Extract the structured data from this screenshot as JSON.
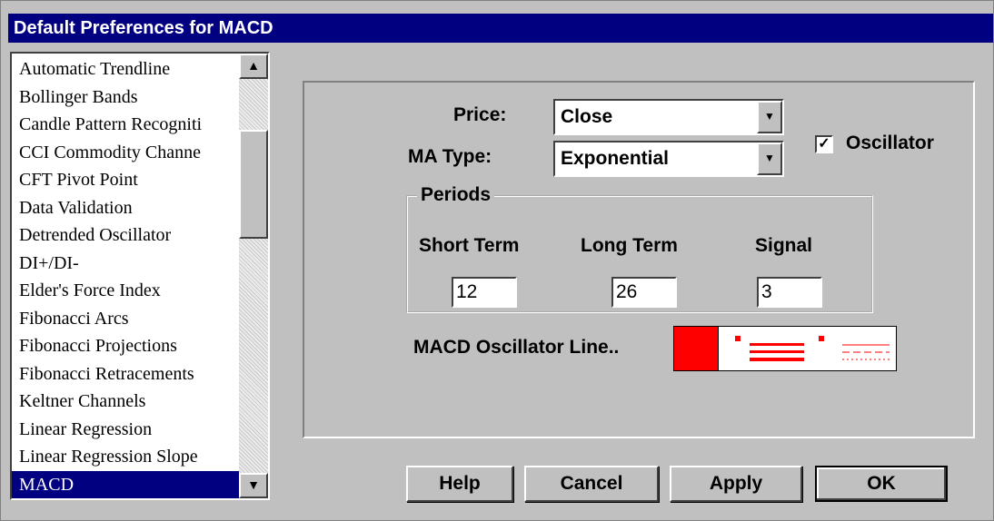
{
  "window": {
    "title": "Default Preferences for MACD"
  },
  "indicator_list": {
    "items": [
      "Automatic Trendline",
      "Bollinger Bands",
      "Candle Pattern Recogniti",
      "CCI Commodity Channe",
      "CFT Pivot Point",
      "Data Validation",
      "Detrended Oscillator",
      "DI+/DI-",
      "Elder's Force Index",
      "Fibonacci Arcs",
      "Fibonacci Projections",
      "Fibonacci Retracements",
      "Keltner Channels",
      "Linear Regression",
      "Linear Regression Slope",
      "MACD"
    ],
    "selected": "MACD",
    "scroll_up_icon": "up-arrow-icon",
    "scroll_down_icon": "down-arrow-icon"
  },
  "settings": {
    "price_label": "Price:",
    "price_value": "Close",
    "ma_type_label": "MA Type:",
    "ma_type_value": "Exponential",
    "oscillator_label": "Oscillator",
    "oscillator_checked": true,
    "periods": {
      "title": "Periods",
      "short_term_label": "Short Term",
      "short_term_value": "12",
      "long_term_label": "Long Term",
      "long_term_value": "26",
      "signal_label": "Signal",
      "signal_value": "3"
    },
    "oscillator_line_label": "MACD Oscillator Line..",
    "oscillator_line_color": "#ff0000"
  },
  "buttons": {
    "help": "Help",
    "cancel": "Cancel",
    "apply": "Apply",
    "ok": "OK"
  },
  "colors": {
    "title_bar": "#000080",
    "dialog_bg": "#c0c0c0",
    "selection": "#000080",
    "line_swatch": "#ff0000"
  }
}
